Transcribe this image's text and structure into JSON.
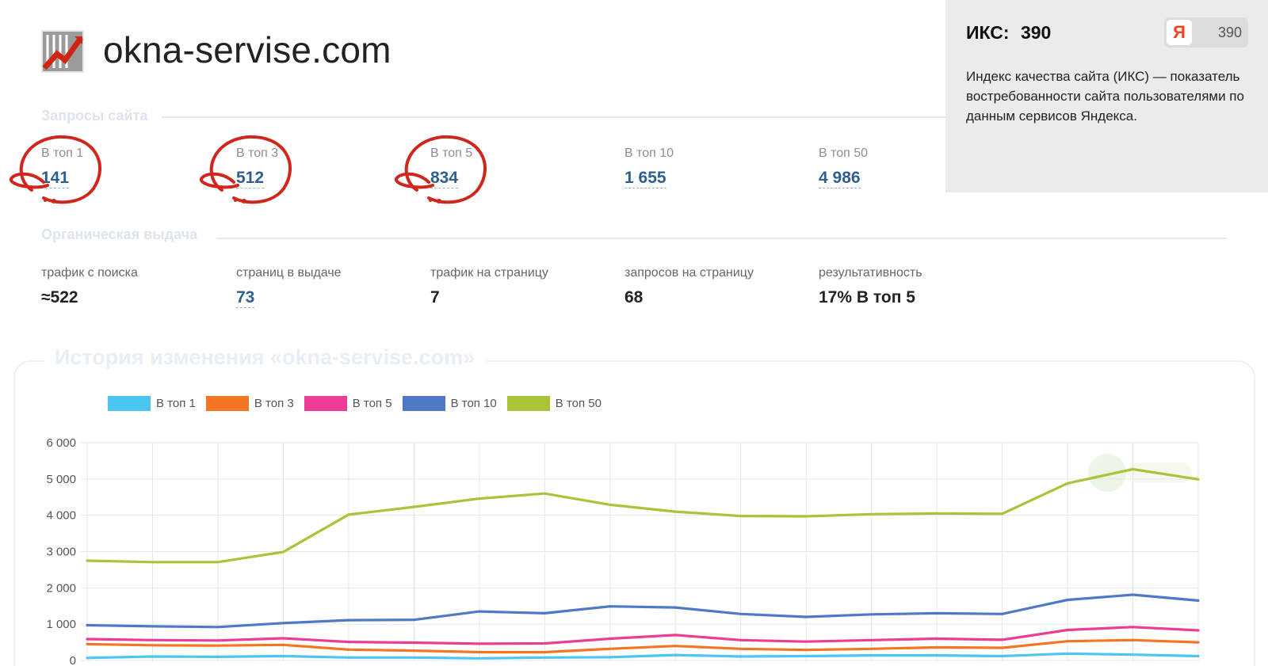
{
  "site": {
    "domain": "okna-servise.com",
    "logo_icon": "site-favicon-logo"
  },
  "queries": {
    "section_title": "Запросы сайта",
    "metrics": [
      {
        "label": "В топ 1",
        "value": "141",
        "circled": true
      },
      {
        "label": "В топ 3",
        "value": "512",
        "circled": true
      },
      {
        "label": "В топ 5",
        "value": "834",
        "circled": true
      },
      {
        "label": "В топ 10",
        "value": "1 655",
        "circled": false
      },
      {
        "label": "В топ 50",
        "value": "4 986",
        "circled": false
      }
    ],
    "circle_color": "#d0271d"
  },
  "organic": {
    "section_title": "Органическая выдача",
    "metrics": [
      {
        "label": "трафик с поиска",
        "value": "≈522"
      },
      {
        "label": "страниц в выдаче",
        "value": "73"
      },
      {
        "label": "трафик на страницу",
        "value": "7"
      },
      {
        "label": "запросов на страницу",
        "value": "68"
      },
      {
        "label": "результативность",
        "value": "17% В топ 5"
      }
    ]
  },
  "iks": {
    "label": "ИКС:",
    "value": "390",
    "badge_logo": "Я",
    "badge_value": "390",
    "description": "Индекс качества сайта (ИКС) — показатель востребованности сайта пользователями по данным сервисов Яндекса."
  },
  "history": {
    "title": "История изменения «okna-servise.com»"
  },
  "chart_data": {
    "type": "line",
    "title": "История изменения «okna-servise.com»",
    "legend_position": "top-left",
    "grid": true,
    "ylim": [
      0,
      6000
    ],
    "y_ticks": [
      "0",
      "1 000",
      "2 000",
      "3 000",
      "4 000",
      "5 000",
      "6 000"
    ],
    "x": [
      1,
      2,
      3,
      4,
      5,
      6,
      7,
      8,
      9,
      10,
      11,
      12,
      13,
      14,
      15,
      16,
      17,
      18
    ],
    "series": [
      {
        "name": "В топ 1",
        "color": "#4bc6f3",
        "values": [
          70,
          110,
          100,
          120,
          80,
          80,
          60,
          80,
          90,
          150,
          110,
          120,
          140,
          140,
          120,
          190,
          160,
          120
        ]
      },
      {
        "name": "В топ 3",
        "color": "#f47524",
        "values": [
          450,
          420,
          410,
          430,
          300,
          270,
          230,
          230,
          320,
          400,
          320,
          290,
          320,
          360,
          350,
          530,
          560,
          500
        ]
      },
      {
        "name": "В топ 5",
        "color": "#ec3d95",
        "values": [
          590,
          560,
          550,
          610,
          510,
          490,
          460,
          470,
          600,
          700,
          560,
          520,
          560,
          600,
          570,
          840,
          920,
          830
        ]
      },
      {
        "name": "В топ 10",
        "color": "#4f79c7",
        "values": [
          970,
          940,
          920,
          1030,
          1110,
          1120,
          1350,
          1300,
          1490,
          1460,
          1280,
          1200,
          1270,
          1300,
          1280,
          1670,
          1810,
          1650
        ]
      },
      {
        "name": "В топ 50",
        "color": "#a9c43b",
        "values": [
          2750,
          2710,
          2710,
          2990,
          4020,
          4230,
          4460,
          4600,
          4290,
          4100,
          3980,
          3970,
          4030,
          4050,
          4040,
          4880,
          5270,
          4990
        ]
      }
    ]
  }
}
